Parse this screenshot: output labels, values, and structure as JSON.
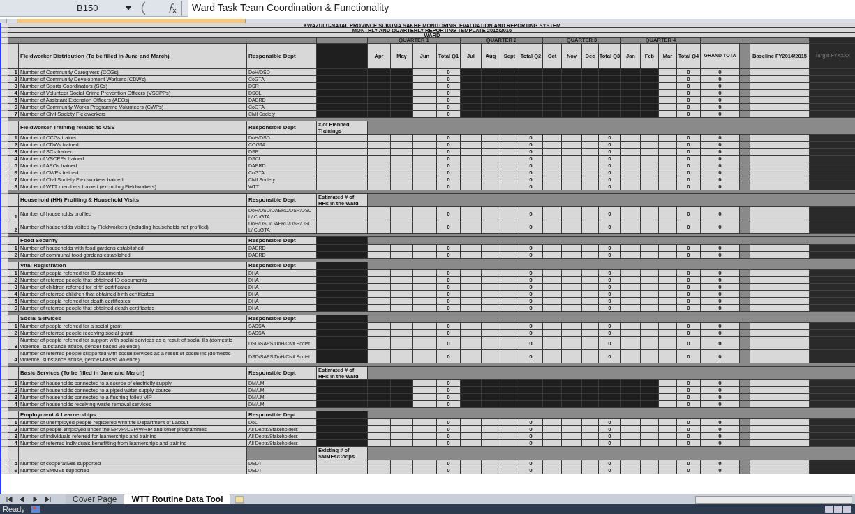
{
  "formula_bar": {
    "cell": "B150",
    "formula": "Ward Task Team Coordination & Functionality"
  },
  "titles": [
    "KWAZULU-NATAL PROVINCE SUKUMA SAKHE MONITORING, EVALUATION AND REPORTING SYSTEM",
    "MONTHLY AND QUARTERLY REPORTING TEMPLATE  2015/2016",
    "WARD"
  ],
  "quarters": [
    {
      "label": "QUARTER 1",
      "columns": [
        "Apr",
        "May",
        "Jun",
        "Total Q1"
      ]
    },
    {
      "label": "QUARTER 2",
      "columns": [
        "Jul",
        "Aug",
        "Sept",
        "Total Q2"
      ]
    },
    {
      "label": "QUARTER 3",
      "columns": [
        "Oct",
        "Nov",
        "Dec",
        "Total Q3"
      ]
    },
    {
      "label": "QUARTER 4",
      "columns": [
        "Jan",
        "Feb",
        "Mar",
        "Total Q4"
      ]
    }
  ],
  "grand_total_header": "GRAND TOTA",
  "baseline_header": "Baseline FY2014/2015",
  "target_header": "Target FYXXXX",
  "sections": [
    {
      "kind": "section",
      "title": "Fieldworker Distribution (To be filled in June and March)",
      "dept_header": "Responsible Dept",
      "d_masked": true,
      "months_masked": true,
      "items": [
        {
          "number": "1",
          "description": "Number of Community Caregivers (CCGs)",
          "dept": "DoH/DSD",
          "totals": {
            "q1": "0",
            "q4": "0"
          },
          "grand_total": "0"
        },
        {
          "number": "2",
          "description": "Number of Community Development Workers (CDWs)",
          "dept": "CoGTA",
          "totals": {
            "q1": "0",
            "q4": "0"
          },
          "grand_total": "0"
        },
        {
          "number": "3",
          "description": "Number of Sports Coordinators (SCs)",
          "dept": "DSR",
          "totals": {
            "q1": "0",
            "q4": "0"
          },
          "grand_total": "0"
        },
        {
          "number": "4",
          "description": "Number of Volunteer Social Crime Prevention Officers (VSCPPs)",
          "dept": "DSCL",
          "totals": {
            "q1": "0",
            "q4": "0"
          },
          "grand_total": "0"
        },
        {
          "number": "5",
          "description": "Number of Assistant Extension Officers (AEOs)",
          "dept": "DAERD",
          "totals": {
            "q1": "0",
            "q4": "0"
          },
          "grand_total": "0"
        },
        {
          "number": "6",
          "description": "Number of Community Works Programme Volunteers (CWPs)",
          "dept": "CoGTA",
          "totals": {
            "q1": "0",
            "q4": "0"
          },
          "grand_total": "0"
        },
        {
          "number": "7",
          "description": "Number of Civil Society Fieldworkers",
          "dept": "Civil Society",
          "totals": {
            "q1": "0",
            "q4": "0"
          },
          "grand_total": "0"
        }
      ]
    },
    {
      "kind": "section",
      "title": "Fieldworker Training related to OSS",
      "dept_header": "Responsible Dept",
      "d_header": "# of Planned Trainings",
      "d_masked": false,
      "months_masked": false,
      "items": [
        {
          "number": "1",
          "description": "Number of CCGs trained",
          "dept": "DoH/DSD",
          "totals": {
            "q1": "0",
            "q2": "0",
            "q3": "0",
            "q4": "0"
          },
          "grand_total": "0"
        },
        {
          "number": "2",
          "description": "Number of CDWs trained",
          "dept": "COGTA",
          "totals": {
            "q1": "0",
            "q2": "0",
            "q3": "0",
            "q4": "0"
          },
          "grand_total": "0"
        },
        {
          "number": "3",
          "description": "Number of SCs trained",
          "dept": "DSR",
          "totals": {
            "q1": "0",
            "q2": "0",
            "q3": "0",
            "q4": "0"
          },
          "grand_total": "0"
        },
        {
          "number": "4",
          "description": "Number of VSCPPs trained",
          "dept": "DSCL",
          "totals": {
            "q1": "0",
            "q2": "0",
            "q3": "0",
            "q4": "0"
          },
          "grand_total": "0"
        },
        {
          "number": "5",
          "description": "Number of AEOs trained",
          "dept": "DAERD",
          "totals": {
            "q1": "0",
            "q2": "0",
            "q3": "0",
            "q4": "0"
          },
          "grand_total": "0"
        },
        {
          "number": "6",
          "description": "Number of CWPs trained",
          "dept": "CoGTA",
          "totals": {
            "q1": "0",
            "q2": "0",
            "q3": "0",
            "q4": "0"
          },
          "grand_total": "0"
        },
        {
          "number": "7",
          "description": "Number of Civil Society Fieldworkers trained",
          "dept": "Civil Society",
          "totals": {
            "q1": "0",
            "q2": "0",
            "q3": "0",
            "q4": "0"
          },
          "grand_total": "0"
        },
        {
          "number": "8",
          "description": "Number of WTT members trained (excluding Fieldworkers)",
          "dept": "WTT",
          "totals": {
            "q1": "0",
            "q2": "0",
            "q3": "0",
            "q4": "0"
          },
          "grand_total": "0"
        }
      ]
    },
    {
      "kind": "section",
      "title": "Household (HH) Profiling & Household Visits",
      "dept_header": "Responsible Dept",
      "d_header": "Estimated # of HHs in the Ward",
      "d_masked": false,
      "months_masked": false,
      "items": [
        {
          "number": "1",
          "description": "Number of households profiled",
          "dept": "DoH/DSD/DAERD/DSR/DSCL/ CoGTA",
          "totals": {
            "q1": "0",
            "q2": "0",
            "q3": "0",
            "q4": "0"
          },
          "grand_total": "0"
        },
        {
          "number": "2",
          "description": "Number of households visited by Fieldworkers (including households not profiled)",
          "dept": "DoH/DSD/DAERD/DSR/DSCL/ CoGTA",
          "totals": {
            "q1": "0",
            "q2": "0",
            "q3": "0",
            "q4": "0"
          },
          "grand_total": "0"
        }
      ]
    },
    {
      "kind": "section",
      "title": "Food Security",
      "dept_header": "Responsible Dept",
      "d_masked": true,
      "months_masked": false,
      "items": [
        {
          "number": "1",
          "description": "Number of households with food gardens established",
          "dept": "DAERD",
          "totals": {
            "q1": "0",
            "q2": "0",
            "q3": "0",
            "q4": "0"
          },
          "grand_total": "0"
        },
        {
          "number": "2",
          "description": "Number of communal food gardens established",
          "dept": "DAERD",
          "totals": {
            "q1": "0",
            "q2": "0",
            "q3": "0",
            "q4": "0"
          },
          "grand_total": "0"
        }
      ]
    },
    {
      "kind": "section",
      "title": "Vital Registration",
      "dept_header": "Responsible Dept",
      "d_masked": true,
      "months_masked": false,
      "items": [
        {
          "number": "1",
          "description": "Number of people referred for ID documents",
          "dept": "DHA",
          "totals": {
            "q1": "0",
            "q2": "0",
            "q3": "0",
            "q4": "0"
          },
          "grand_total": "0"
        },
        {
          "number": "2",
          "description": "Number of referred people that obtained ID documents",
          "dept": "DHA",
          "totals": {
            "q1": "0",
            "q2": "0",
            "q3": "0",
            "q4": "0"
          },
          "grand_total": "0"
        },
        {
          "number": "3",
          "description": "Number of children referred for birth certificates",
          "dept": "DHA",
          "totals": {
            "q1": "0",
            "q2": "0",
            "q3": "0",
            "q4": "0"
          },
          "grand_total": "0"
        },
        {
          "number": "4",
          "description": "Number of referred children that obtained birth certificates",
          "dept": "DHA",
          "totals": {
            "q1": "0",
            "q2": "0",
            "q3": "0",
            "q4": "0"
          },
          "grand_total": "0"
        },
        {
          "number": "5",
          "description": "Number of people referred for death certificates",
          "dept": "DHA",
          "totals": {
            "q1": "0",
            "q2": "0",
            "q3": "0",
            "q4": "0"
          },
          "grand_total": "0"
        },
        {
          "number": "6",
          "description": "Number of referred people that obtained death certificates",
          "dept": "DHA",
          "totals": {
            "q1": "0",
            "q2": "0",
            "q3": "0",
            "q4": "0"
          },
          "grand_total": "0"
        }
      ]
    },
    {
      "kind": "section",
      "title": "Social Services",
      "dept_header": "Responsible Dept",
      "d_masked": true,
      "months_masked": false,
      "items": [
        {
          "number": "1",
          "description": "Number of people referred for a social grant",
          "dept": "SASSA",
          "totals": {
            "q1": "0",
            "q2": "0",
            "q3": "0",
            "q4": "0"
          },
          "grand_total": "0"
        },
        {
          "number": "2",
          "description": "Number of referred people receiving social grant",
          "dept": "SASSA",
          "totals": {
            "q1": "0",
            "q2": "0",
            "q3": "0",
            "q4": "0"
          },
          "grand_total": "0"
        },
        {
          "number": "3",
          "description": "Number of people referred for support with social services as a result of social ills (domestic violence, substance abuse, gender-based violence)",
          "dept": "DSD/SAPS/DoH/Civil Societ",
          "totals": {
            "q1": "0",
            "q2": "0",
            "q3": "0",
            "q4": "0"
          },
          "grand_total": "0"
        },
        {
          "number": "4",
          "description": "Number of referred people supported with social services as a result of social ills (domestic violence, substance abuse, gender-based violence)",
          "dept": "DSD/SAPS/DoH/Civil Societ",
          "totals": {
            "q1": "0",
            "q2": "0",
            "q3": "0",
            "q4": "0"
          },
          "grand_total": "0"
        }
      ]
    },
    {
      "kind": "section",
      "title": "Basic Services (To be filled in June  and March)",
      "dept_header": "Responsible Dept",
      "d_header": "Estimated # of HHs in the Ward",
      "d_masked": true,
      "months_masked": true,
      "items": [
        {
          "number": "1",
          "description": "Number of households connected to a source of electricity supply",
          "dept": "DM/LM",
          "totals": {
            "q1": "0",
            "q4": "0"
          },
          "grand_total": "0"
        },
        {
          "number": "2",
          "description": "Number of households connected to a piped water supply source",
          "dept": "DM/LM",
          "totals": {
            "q1": "0",
            "q4": "0"
          },
          "grand_total": "0"
        },
        {
          "number": "3",
          "description": "Number of households connected to a flushing toilet/ VIP",
          "dept": "DM/LM",
          "totals": {
            "q1": "0",
            "q4": "0"
          },
          "grand_total": "0"
        },
        {
          "number": "4",
          "description": "Number of households receiving waste removal services",
          "dept": "DM/LM",
          "totals": {
            "q1": "0",
            "q4": "0"
          },
          "grand_total": "0"
        }
      ]
    },
    {
      "kind": "section",
      "title": "Employment & Learnerships",
      "dept_header": "Responsible Dept",
      "d_masked": true,
      "months_masked": false,
      "items": [
        {
          "number": "1",
          "description": "Number of unemployed people registered with the Department of Labour",
          "dept": "DoL",
          "totals": {
            "q1": "0",
            "q2": "0",
            "q3": "0",
            "q4": "0"
          },
          "grand_total": "0"
        },
        {
          "number": "2",
          "description": "Number of people employed under the EPVP/CVP/WRIP and other programmes",
          "dept": "All Depts/Stakeholders",
          "totals": {
            "q1": "0",
            "q2": "0",
            "q3": "0",
            "q4": "0"
          },
          "grand_total": "0"
        },
        {
          "number": "3",
          "description": "Number of individuals referred for learnerships and training",
          "dept": "All Depts/Stakeholders",
          "totals": {
            "q1": "0",
            "q2": "0",
            "q3": "0",
            "q4": "0"
          },
          "grand_total": "0"
        },
        {
          "number": "4",
          "description": "Number of referred individuals benefitting from learnerships and training",
          "dept": "All Depts/Stakeholders",
          "totals": {
            "q1": "0",
            "q2": "0",
            "q3": "0",
            "q4": "0"
          },
          "grand_total": "0"
        }
      ]
    },
    {
      "kind": "subsection",
      "d_header": "Existing # of SMMEs/Coops",
      "d_masked": false,
      "months_masked": false,
      "items": [
        {
          "number": "5",
          "description": "Number of cooperatives supported",
          "dept": "DEDT",
          "totals": {
            "q1": "0",
            "q2": "0",
            "q3": "0",
            "q4": "0"
          },
          "grand_total": "0"
        },
        {
          "number": "6",
          "description": "Number of SMMEs supported",
          "dept": "DEDT",
          "totals": {
            "q1": "0",
            "q2": "0",
            "q3": "0",
            "q4": "0"
          },
          "grand_total": "0"
        }
      ]
    }
  ],
  "sheet_tabs": [
    {
      "label": "Cover Page",
      "selected": false
    },
    {
      "label": "WTT Routine Data Tool",
      "selected": true
    }
  ],
  "status": "Ready"
}
